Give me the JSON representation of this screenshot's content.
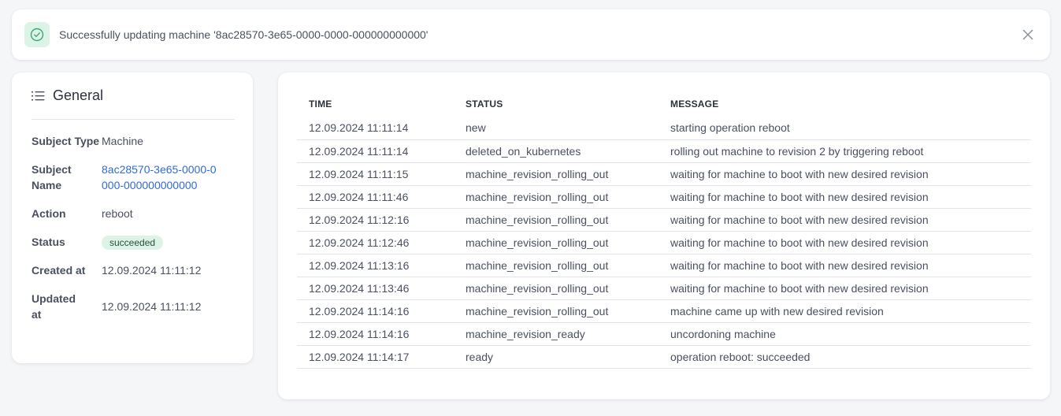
{
  "toast": {
    "message": "Successfully updating machine '8ac28570-3e65-0000-0000-000000000000'",
    "colors": {
      "icon_bg": "#dcf3e8",
      "icon_stroke": "#3aa876"
    }
  },
  "general": {
    "title": "General",
    "fields": [
      {
        "label": "Subject Type",
        "value": "Machine"
      },
      {
        "label": "Subject Name",
        "value": "8ac28570-3e65-0000-0000-000000000000"
      },
      {
        "label": "Action",
        "value": "reboot"
      },
      {
        "label": "Status",
        "value": "succeeded"
      },
      {
        "label": "Created at",
        "value": "12.09.2024 11:11:12"
      },
      {
        "label": "Updated at",
        "value": "12.09.2024 11:11:12"
      }
    ]
  },
  "log": {
    "headers": [
      "TIME",
      "STATUS",
      "MESSAGE"
    ],
    "rows": [
      [
        "12.09.2024 11:11:14",
        "new",
        "starting operation reboot"
      ],
      [
        "12.09.2024 11:11:14",
        "deleted_on_kubernetes",
        "rolling out machine to revision 2 by triggering reboot"
      ],
      [
        "12.09.2024 11:11:15",
        "machine_revision_rolling_out",
        "waiting for machine to boot with new desired revision"
      ],
      [
        "12.09.2024 11:11:46",
        "machine_revision_rolling_out",
        "waiting for machine to boot with new desired revision"
      ],
      [
        "12.09.2024 11:12:16",
        "machine_revision_rolling_out",
        "waiting for machine to boot with new desired revision"
      ],
      [
        "12.09.2024 11:12:46",
        "machine_revision_rolling_out",
        "waiting for machine to boot with new desired revision"
      ],
      [
        "12.09.2024 11:13:16",
        "machine_revision_rolling_out",
        "waiting for machine to boot with new desired revision"
      ],
      [
        "12.09.2024 11:13:46",
        "machine_revision_rolling_out",
        "waiting for machine to boot with new desired revision"
      ],
      [
        "12.09.2024 11:14:16",
        "machine_revision_rolling_out",
        "machine came up with new desired revision"
      ],
      [
        "12.09.2024 11:14:16",
        "machine_revision_ready",
        "uncordoning machine"
      ],
      [
        "12.09.2024 11:14:17",
        "ready",
        "operation reboot: succeeded"
      ]
    ]
  }
}
